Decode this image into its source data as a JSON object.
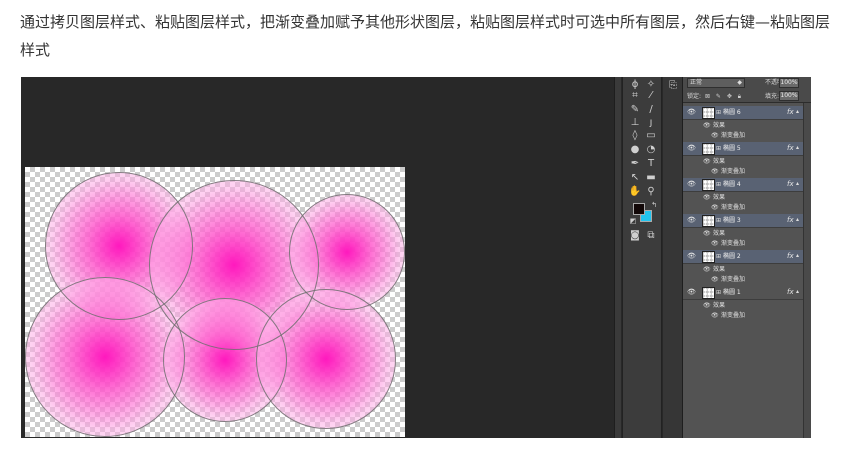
{
  "instruction": {
    "text": "通过拷贝图层样式、粘贴图层样式，把渐变叠加赋予其他形状图层，粘贴图层样式时可选中所有图层，然后右键—粘贴图层样式"
  },
  "layers_panel": {
    "blend_mode": "正常",
    "opacity_label": "不透明度:",
    "opacity_value": "100%",
    "lock_label": "锁定:",
    "fill_label": "填充:",
    "fill_value": "100%",
    "effects_label": "效果",
    "effect_name": "渐变叠加",
    "fx_label": "fx",
    "layers": [
      {
        "name": "椭圆 6",
        "selected": true
      },
      {
        "name": "椭圆 5",
        "selected": true
      },
      {
        "name": "椭圆 4",
        "selected": true
      },
      {
        "name": "椭圆 3",
        "selected": true
      },
      {
        "name": "椭圆 2",
        "selected": true
      },
      {
        "name": "椭圆 1",
        "selected": false
      }
    ]
  },
  "toolbar": {
    "tools": [
      "lasso-tool-icon",
      "magic-wand-icon",
      "crop-tool-icon",
      "eyedropper-icon",
      "healing-brush-icon",
      "brush-tool-icon",
      "clone-stamp-icon",
      "history-brush-icon",
      "eraser-icon",
      "gradient-tool-icon",
      "blur-tool-icon",
      "dodge-tool-icon",
      "pen-tool-icon",
      "type-tool-icon",
      "path-selection-icon",
      "shape-tool-icon",
      "hand-tool-icon",
      "zoom-tool-icon"
    ],
    "foreground_color": "#120808",
    "background_color": "#22c4ee"
  },
  "colors": {
    "workspace": "#282828",
    "panel": "#535353",
    "selected_layer": "#596273",
    "gradient_center": "#ff19be"
  }
}
